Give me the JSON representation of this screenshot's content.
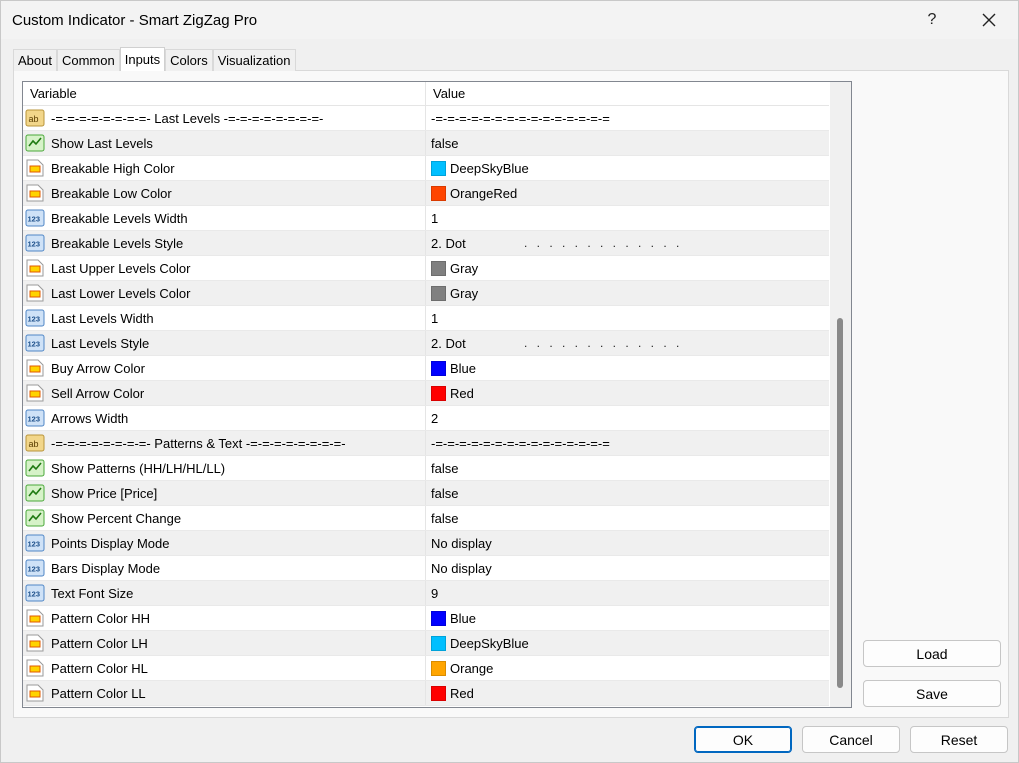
{
  "window": {
    "title": "Custom Indicator - Smart ZigZag Pro",
    "help_label": "?"
  },
  "tabs": [
    {
      "label": "About"
    },
    {
      "label": "Common"
    },
    {
      "label": "Inputs"
    },
    {
      "label": "Colors"
    },
    {
      "label": "Visualization"
    }
  ],
  "active_tab": "Inputs",
  "grid": {
    "headers": {
      "variable": "Variable",
      "value": "Value"
    },
    "rows": [
      {
        "icon": "ab",
        "variable": "-=-=-=-=-=-=-=-=- Last Levels -=-=-=-=-=-=-=-=-",
        "value": "-=-=-=-=-=-=-=-=-=-=-=-=-=-=-="
      },
      {
        "icon": "bool",
        "variable": "Show Last Levels",
        "value": "false"
      },
      {
        "icon": "color",
        "variable": "Breakable High Color",
        "value": "DeepSkyBlue",
        "swatch": "#00bfff"
      },
      {
        "icon": "color",
        "variable": "Breakable Low Color",
        "value": "OrangeRed",
        "swatch": "#ff4500"
      },
      {
        "icon": "int",
        "variable": "Breakable Levels Width",
        "value": "1"
      },
      {
        "icon": "int",
        "variable": "Breakable Levels Style",
        "value": "2. Dot",
        "dots": ". . . . . . . . . . . . ."
      },
      {
        "icon": "color",
        "variable": "Last Upper Levels Color",
        "value": "Gray",
        "swatch": "#808080"
      },
      {
        "icon": "color",
        "variable": "Last Lower Levels Color",
        "value": "Gray",
        "swatch": "#808080"
      },
      {
        "icon": "int",
        "variable": "Last Levels Width",
        "value": "1"
      },
      {
        "icon": "int",
        "variable": "Last Levels Style",
        "value": "2. Dot",
        "dots": ". . . . . . . . . . . . ."
      },
      {
        "icon": "color",
        "variable": "Buy Arrow Color",
        "value": "Blue",
        "swatch": "#0000ff"
      },
      {
        "icon": "color",
        "variable": "Sell Arrow Color",
        "value": "Red",
        "swatch": "#ff0000"
      },
      {
        "icon": "int",
        "variable": "Arrows Width",
        "value": "2"
      },
      {
        "icon": "ab",
        "variable": "-=-=-=-=-=-=-=-=- Patterns & Text -=-=-=-=-=-=-=-=-",
        "value": "-=-=-=-=-=-=-=-=-=-=-=-=-=-=-="
      },
      {
        "icon": "bool",
        "variable": "Show Patterns (HH/LH/HL/LL)",
        "value": "false"
      },
      {
        "icon": "bool",
        "variable": "Show Price [Price]",
        "value": "false"
      },
      {
        "icon": "bool",
        "variable": "Show Percent Change",
        "value": "false"
      },
      {
        "icon": "int",
        "variable": "Points Display Mode",
        "value": "No display"
      },
      {
        "icon": "int",
        "variable": "Bars Display Mode",
        "value": "No display"
      },
      {
        "icon": "int",
        "variable": "Text Font Size",
        "value": "9"
      },
      {
        "icon": "color",
        "variable": "Pattern Color HH",
        "value": "Blue",
        "swatch": "#0000ff"
      },
      {
        "icon": "color",
        "variable": "Pattern Color LH",
        "value": "DeepSkyBlue",
        "swatch": "#00bfff"
      },
      {
        "icon": "color",
        "variable": "Pattern Color HL",
        "value": "Orange",
        "swatch": "#ffa500"
      },
      {
        "icon": "color",
        "variable": "Pattern Color LL",
        "value": "Red",
        "swatch": "#ff0000"
      }
    ]
  },
  "buttons": {
    "load": "Load",
    "save": "Save",
    "ok": "OK",
    "cancel": "Cancel",
    "reset": "Reset"
  },
  "colors": {
    "accent": "#0067c0"
  }
}
